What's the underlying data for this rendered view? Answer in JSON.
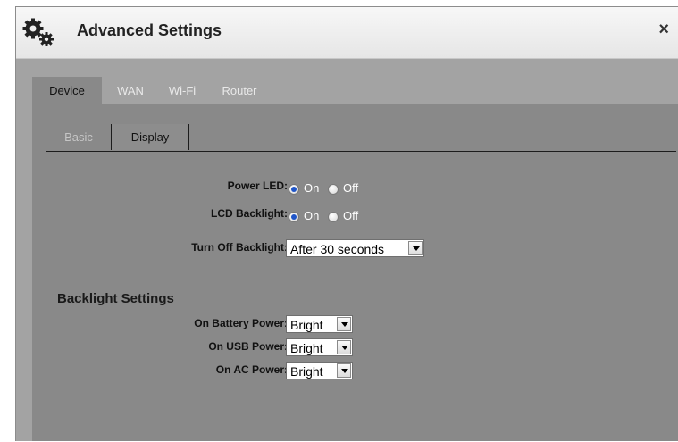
{
  "dialog": {
    "title": "Advanced Settings",
    "icon": "gears-icon",
    "close_label": "×"
  },
  "tabs": [
    {
      "label": "Device",
      "active": true
    },
    {
      "label": "WAN",
      "active": false
    },
    {
      "label": "Wi-Fi",
      "active": false
    },
    {
      "label": "Router",
      "active": false
    }
  ],
  "subtabs": [
    {
      "label": "Basic",
      "active": false
    },
    {
      "label": "Display",
      "active": true
    }
  ],
  "display": {
    "power_led": {
      "label": "Power LED:",
      "on_label": "On",
      "off_label": "Off",
      "selected": "On"
    },
    "lcd_backlight": {
      "label": "LCD Backlight:",
      "on_label": "On",
      "off_label": "Off",
      "selected": "On"
    },
    "turn_off_backlight": {
      "label": "Turn Off Backlight:",
      "value": "After 30 seconds"
    }
  },
  "backlight_settings": {
    "heading": "Backlight Settings",
    "battery": {
      "label": "On Battery Power:",
      "value": "Bright"
    },
    "usb": {
      "label": "On USB Power:",
      "value": "Bright"
    },
    "ac": {
      "label": "On AC Power:",
      "value": "Bright"
    }
  },
  "colors": {
    "dialog_bg": "#a3a3a3",
    "panel_bg": "#898989",
    "radio_dot": "#1f55c8"
  }
}
